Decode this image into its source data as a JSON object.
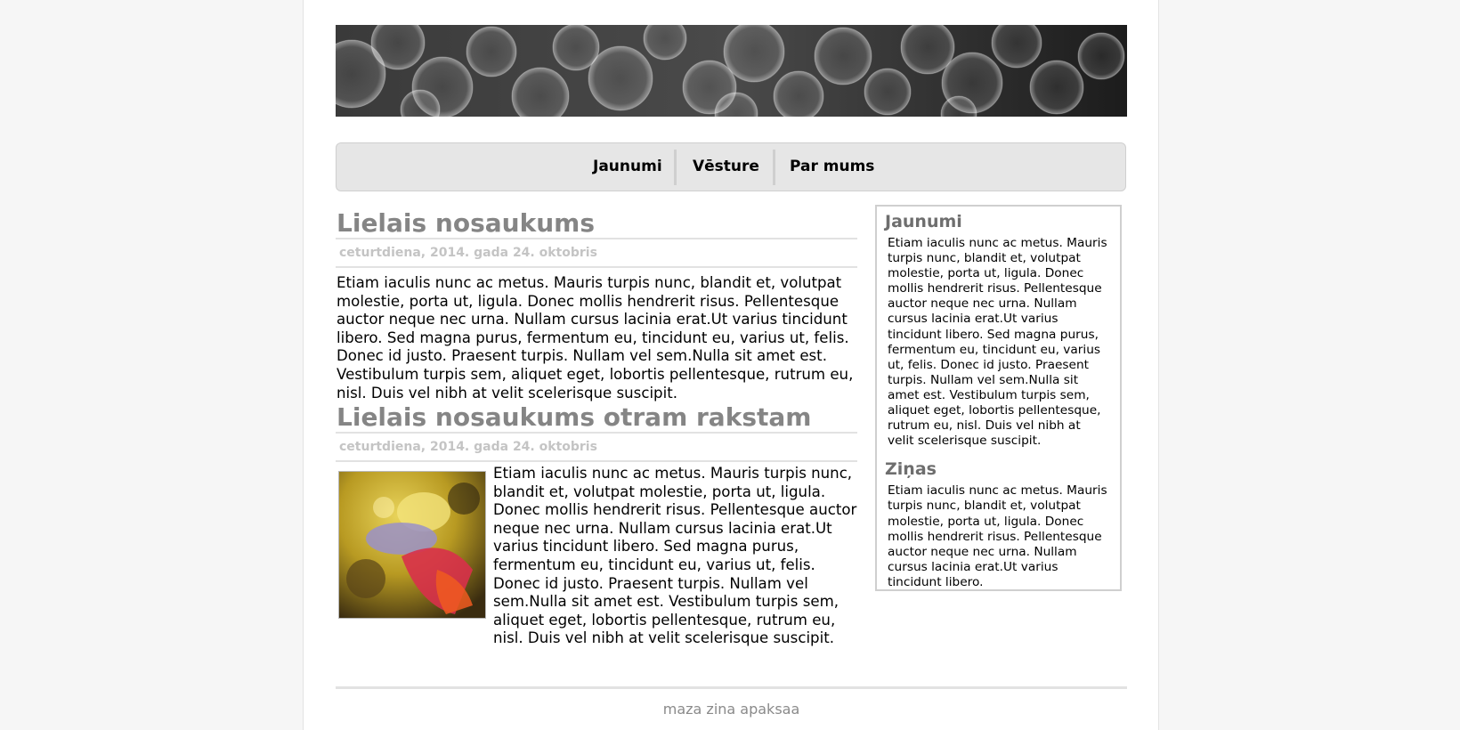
{
  "nav": {
    "items": [
      {
        "label": "Jaunumi"
      },
      {
        "label": "Vēsture"
      },
      {
        "label": "Par mums"
      }
    ]
  },
  "articles": [
    {
      "title": "Lielais nosaukums",
      "date": "ceturtdiena, 2014. gada 24. oktobris",
      "body": "Etiam iaculis nunc ac metus. Mauris turpis nunc, blandit et, volutpat molestie, porta ut, ligula. Donec mollis hendrerit risus. Pellentesque auctor neque nec urna. Nullam cursus lacinia erat.Ut varius tincidunt libero. Sed magna purus, fermentum eu, tincidunt eu, varius ut, felis. Donec id justo. Praesent turpis. Nullam vel sem.Nulla sit amet est. Vestibulum turpis sem, aliquet eget, lobortis pellentesque, rutrum eu, nisl. Duis vel nibh at velit scelerisque suscipit."
    },
    {
      "title": "Lielais nosaukums otram rakstam",
      "date": "ceturtdiena, 2014. gada 24. oktobris",
      "body": "Etiam iaculis nunc ac metus. Mauris turpis nunc, blandit et, volutpat molestie, porta ut, ligula. Donec mollis hendrerit risus. Pellentesque auctor neque nec urna. Nullam cursus lacinia erat.Ut varius tincidunt libero. Sed magna purus, fermentum eu, tincidunt eu, varius ut, felis. Donec id justo. Praesent turpis. Nullam vel sem.Nulla sit amet est. Vestibulum turpis sem, aliquet eget, lobortis pellentesque, rutrum eu, nisl. Duis vel nibh at velit scelerisque suscipit."
    }
  ],
  "sidebar": {
    "sections": [
      {
        "title": "Jaunumi",
        "text": "Etiam iaculis nunc ac metus. Mauris turpis nunc, blandit et, volutpat molestie, porta ut, ligula. Donec mollis hendrerit risus. Pellentesque auctor neque nec urna. Nullam cursus lacinia erat.Ut varius tincidunt libero. Sed magna purus, fermentum eu, tincidunt eu, varius ut, felis. Donec id justo. Praesent turpis. Nullam vel sem.Nulla sit amet est. Vestibulum turpis sem, aliquet eget, lobortis pellentesque, rutrum eu, nisl. Duis vel nibh at velit scelerisque suscipit."
      },
      {
        "title": "Ziņas",
        "text": "Etiam iaculis nunc ac metus. Mauris turpis nunc, blandit et, volutpat molestie, porta ut, ligula. Donec mollis hendrerit risus. Pellentesque auctor neque nec urna. Nullam cursus lacinia erat.Ut varius tincidunt libero."
      }
    ]
  },
  "footer": {
    "text": "maza zina apaksaa"
  }
}
